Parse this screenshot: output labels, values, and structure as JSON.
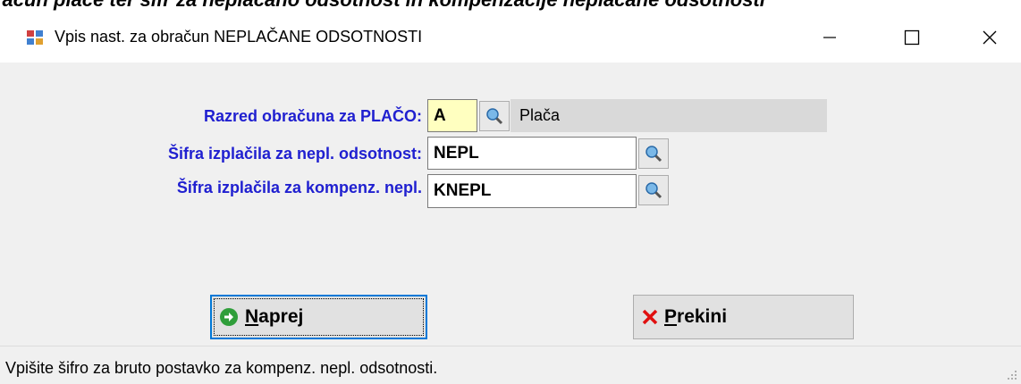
{
  "document_strip": "račun plače ter šifr za neplačano odsotnost in kompenzacije neplačane odsotnosti",
  "window": {
    "title": "Vpis nast. za obračun NEPLAČANE ODSOTNOSTI",
    "controls": {
      "minimize": "—",
      "maximize": "☐",
      "close": "✕"
    }
  },
  "form": {
    "razred": {
      "label": "Razred obračuna za PLAČO:",
      "value": "A",
      "description": "Plača"
    },
    "nepl": {
      "label": "Šifra izplačila za nepl. odsotnost:",
      "value": "NEPL"
    },
    "knepl": {
      "label": "Šifra izplačila za kompenz. nepl.",
      "value": "KNEPL"
    }
  },
  "buttons": {
    "naprej": {
      "mnemonic": "N",
      "rest": "aprej",
      "icon": "arrow-right-icon"
    },
    "prekini": {
      "mnemonic": "P",
      "rest": "rekini",
      "icon": "red-x-icon"
    }
  },
  "status": {
    "text": "Vpišite šifro za bruto postavko za kompenz. nepl. odsotnosti."
  },
  "colors": {
    "label": "#2020d0",
    "accent_focus": "#0078d7",
    "yellow_field": "#ffffc0"
  }
}
